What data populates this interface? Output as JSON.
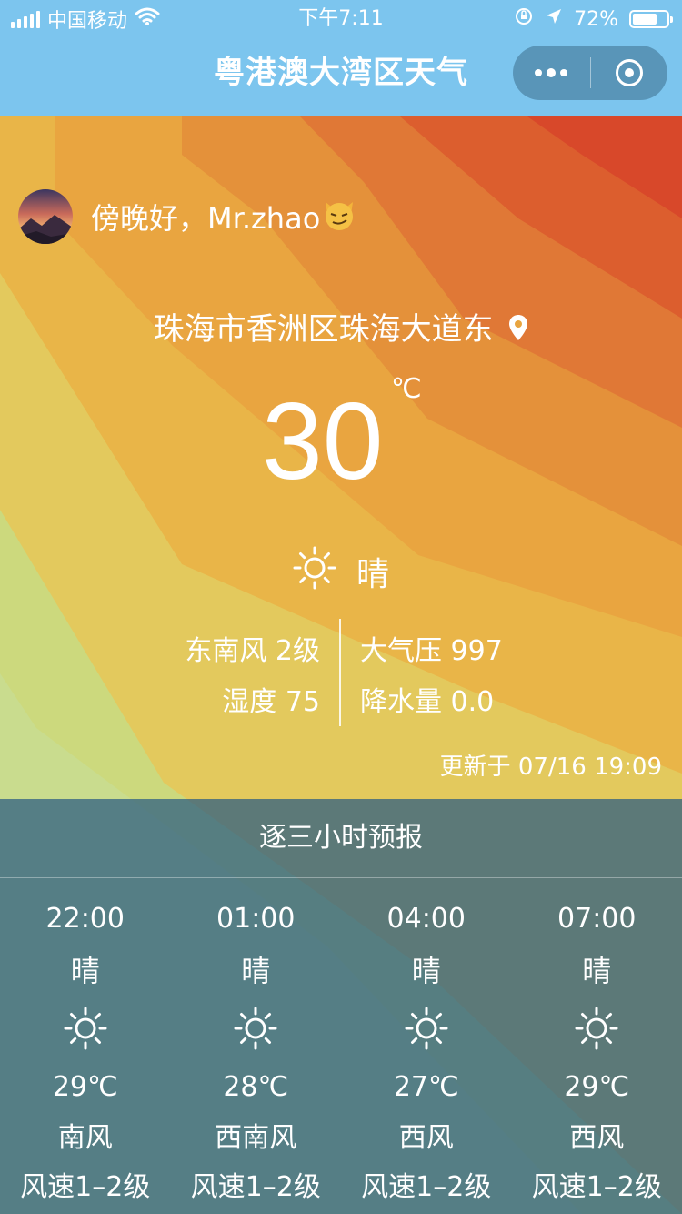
{
  "status_bar": {
    "carrier": "中国移动",
    "time": "下午7:11",
    "battery": "72%",
    "battery_level": 0.72
  },
  "nav": {
    "title": "粤港澳大湾区天气",
    "more_icon": "more-dots-icon",
    "close_icon": "target-circle-icon"
  },
  "greeting": {
    "text": "傍晚好，Mr.zhao",
    "emoji_icon": "smirk-cat-icon"
  },
  "location": "珠海市香洲区珠海大道东",
  "current": {
    "temperature": "30",
    "unit": "℃",
    "condition": "晴",
    "wind": "东南风 2级",
    "humidity": "湿度 75",
    "pressure": "大气压 997",
    "precipitation": "降水量 0.0",
    "updated": "更新于 07/16 19:09"
  },
  "forecast": {
    "title": "逐三小时预报",
    "items": [
      {
        "time": "22:00",
        "condition": "晴",
        "temp": "29℃",
        "wind": "南风",
        "speed": "风速1–2级"
      },
      {
        "time": "01:00",
        "condition": "晴",
        "temp": "28℃",
        "wind": "西南风",
        "speed": "风速1–2级"
      },
      {
        "time": "04:00",
        "condition": "晴",
        "temp": "27℃",
        "wind": "西风",
        "speed": "风速1–2级"
      },
      {
        "time": "07:00",
        "condition": "晴",
        "temp": "29℃",
        "wind": "西风",
        "speed": "风速1–2级"
      }
    ]
  },
  "colors": {
    "sky": "#7cc5ee",
    "band_green": "#c8dc8c",
    "band_yellow": "#e2c95a",
    "band_orange": "#e8a13c",
    "band_red": "#d8442a",
    "forecast_panel": "#4a7590"
  }
}
